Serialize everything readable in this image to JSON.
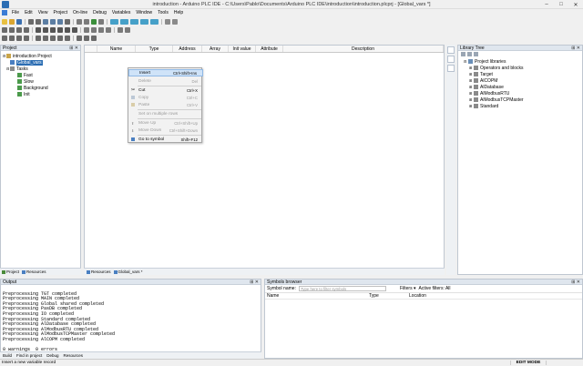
{
  "window": {
    "title": "introduction - Arduino PLC IDE - C:\\Users\\Pablo\\Documents\\Arduino PLC IDE\\introduction\\introduction.plcprj - [Global_vars *]"
  },
  "menu": [
    "File",
    "Edit",
    "View",
    "Project",
    "On-line",
    "Debug",
    "Variables",
    "Window",
    "Tools",
    "Help"
  ],
  "project_panel": {
    "title": "Project",
    "tree": [
      {
        "label": "introduction Project",
        "level": 0
      },
      {
        "label": "Global_vars",
        "level": 1,
        "selected": true
      },
      {
        "label": "Tasks",
        "level": 1
      },
      {
        "label": "Fast",
        "level": 2
      },
      {
        "label": "Slow",
        "level": 2
      },
      {
        "label": "Background",
        "level": 2
      },
      {
        "label": "Init",
        "level": 2
      }
    ],
    "tabs": [
      "Project",
      "Resources"
    ]
  },
  "editor": {
    "columns": [
      "Name",
      "Type",
      "Address",
      "Array",
      "Init value",
      "Attribute",
      "Description"
    ],
    "tabs": [
      "Resources",
      "Global_vars *"
    ]
  },
  "context_menu": [
    {
      "label": "Insert",
      "shortcut": "Ctrl+Shift+Ins",
      "state": "highlighted"
    },
    {
      "label": "Delete",
      "shortcut": "Del",
      "state": "disabled"
    },
    {
      "sep": true
    },
    {
      "label": "Cut",
      "shortcut": "Ctrl+X",
      "state": "enabled",
      "icon": "cut-icon"
    },
    {
      "label": "Copy",
      "shortcut": "Ctrl+C",
      "state": "disabled",
      "icon": "copy-icon"
    },
    {
      "label": "Paste",
      "shortcut": "Ctrl+V",
      "state": "disabled",
      "icon": "paste-icon"
    },
    {
      "sep": true
    },
    {
      "label": "Set on multiple rows",
      "shortcut": "",
      "state": "disabled"
    },
    {
      "sep": true
    },
    {
      "label": "Move Up",
      "shortcut": "Ctrl+Shift+Up",
      "state": "disabled",
      "icon": "move-up-icon"
    },
    {
      "label": "Move Down",
      "shortcut": "Ctrl+Shift+Down",
      "state": "disabled",
      "icon": "move-down-icon"
    },
    {
      "sep": true
    },
    {
      "label": "Go to symbol",
      "shortcut": "Shift+F12",
      "state": "enabled",
      "icon": "goto-icon"
    }
  ],
  "library": {
    "title": "Library Tree",
    "root": "Project libraries",
    "items": [
      "Operators and blocks",
      "Target",
      "AlCOPM",
      "AlDatabase",
      "AlModbusRTU",
      "AlModbusTCPMaster",
      "Standard"
    ]
  },
  "output": {
    "title": "Output",
    "lines": [
      "Preprocessing TGT completed",
      "Preprocessing MAIN completed",
      "Preprocessing Global shared completed",
      "Preprocessing PasDB completed",
      "Preprocessing IO completed",
      "Preprocessing Standard completed",
      "Preprocessing AlDatabase completed",
      "Preprocessing AlModbusRTU completed",
      "Preprocessing AlModbusTCPMaster completed",
      "Preprocessing AlCOPM completed",
      "",
      "0 warnings  0 errors"
    ],
    "tabs": [
      "Build",
      "Find in project",
      "Debug",
      "Resources"
    ]
  },
  "symbols": {
    "title": "Symbols browser",
    "name_label": "Symbol name:",
    "search_placeholder": "Type here to filter symbols",
    "filters_label": "Filters",
    "active_filters": "Active filters: All",
    "columns": [
      "Name",
      "Type",
      "Location"
    ]
  },
  "status": {
    "message": "Insert a new variable record",
    "mode": "EDIT MODE"
  }
}
